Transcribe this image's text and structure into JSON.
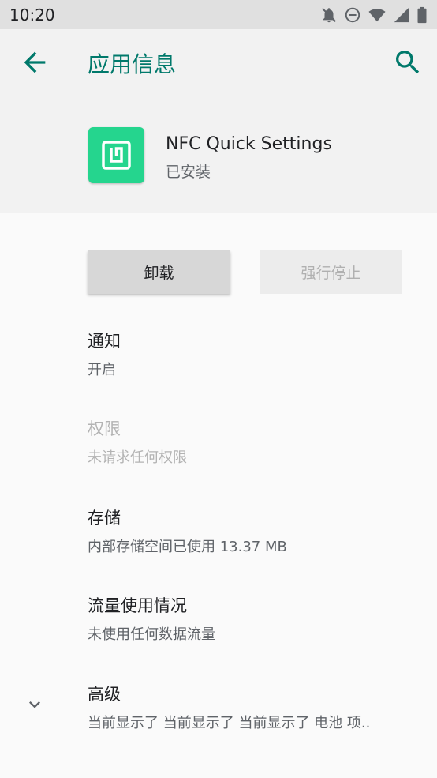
{
  "status_bar": {
    "time": "10:20"
  },
  "app_bar": {
    "title": "应用信息"
  },
  "app_header": {
    "name": "NFC Quick Settings",
    "status": "已安装",
    "icon_color": "#25d58e"
  },
  "buttons": {
    "uninstall": "卸载",
    "force_stop": "强行停止"
  },
  "preferences": [
    {
      "title": "通知",
      "summary": "开启"
    },
    {
      "title": "权限",
      "summary": "未请求任何权限"
    },
    {
      "title": "存储",
      "summary": "内部存储空间已使用 13.37 MB"
    },
    {
      "title": "流量使用情况",
      "summary": "未使用任何数据流量"
    },
    {
      "title": "高级",
      "summary": "当前显示了 当前显示了 当前显示了 电池 项.."
    }
  ],
  "colors": {
    "accent": "#00796b",
    "status_bar_bg": "#e0e0e0",
    "header_bg": "#f2f2f2",
    "page_bg": "#fafafa"
  }
}
